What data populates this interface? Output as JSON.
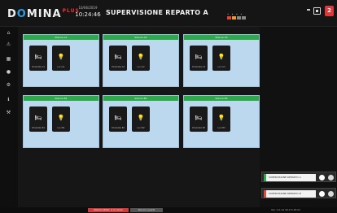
{
  "header": {
    "logo_text_1": "D",
    "logo_text_2": "O",
    "logo_text_3": "MINA",
    "logo_plus": "PLUS",
    "date": "10/06/2019",
    "time": "10:24:46",
    "title": "SUPERVISIONE REPARTO A",
    "alert_count": "2"
  },
  "sidebar": {
    "items": [
      "⌂",
      "⚠",
      "▦",
      "●",
      "⚙",
      "ℹ",
      "⚒"
    ]
  },
  "rooms": [
    {
      "name": "Stanza A1",
      "bed_label": "Chiamata A1",
      "light_label": "Luci A1"
    },
    {
      "name": "Stanza A2",
      "bed_label": "Chiamata A2",
      "light_label": "Luci A2"
    },
    {
      "name": "Stanza A3",
      "bed_label": "Chiamata A3",
      "light_label": "Luci A3"
    },
    {
      "name": "Stanza B1",
      "bed_label": "Chiamata B1",
      "light_label": "Luci B1"
    },
    {
      "name": "Stanza B2",
      "bed_label": "Chiamata B2",
      "light_label": "Luci B2"
    },
    {
      "name": "Stanza B3",
      "bed_label": "Chiamata B3",
      "light_label": "Luci B3"
    }
  ],
  "icons": {
    "bed": "🛏",
    "bulb": "💡"
  },
  "right_panel": {
    "rows": [
      {
        "label": "SUPERVISIONE REPARTO A",
        "state": "normal"
      },
      {
        "label": "SUPERVISIONE REPARTO B",
        "state": "alarm"
      }
    ]
  },
  "footer": {
    "alarm_text": "Allarmi attivi: 2 in corso",
    "info_text": "Storico eventi",
    "version": "Ver. 1.0.14 29.0.3.18.01"
  },
  "colors": {
    "room_bg": "#bcd8ee",
    "room_header": "#2da84a",
    "alert": "#e0383a"
  }
}
